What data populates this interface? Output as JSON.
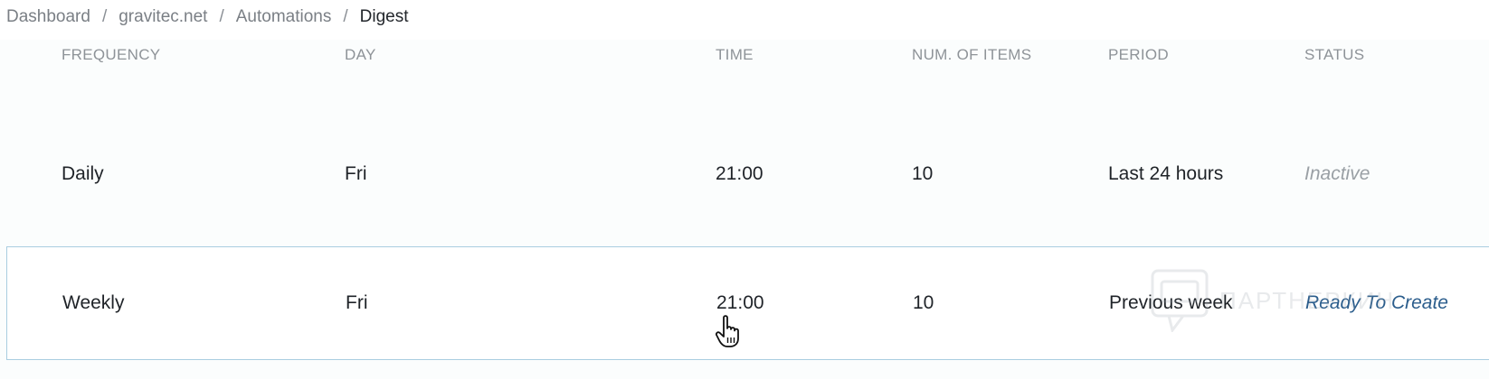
{
  "breadcrumb": {
    "items": [
      "Dashboard",
      "gravitec.net",
      "Automations"
    ],
    "current": "Digest",
    "separator": "/"
  },
  "table": {
    "headers": [
      "FREQUENCY",
      "DAY",
      "TIME",
      "NUM. OF ITEMS",
      "PERIOD",
      "STATUS"
    ],
    "rows": [
      {
        "frequency": "Daily",
        "day": "Fri",
        "time": "21:00",
        "num_items": "10",
        "period": "Last 24 hours",
        "status": "Inactive"
      },
      {
        "frequency": "Weekly",
        "day": "Fri",
        "time": "21:00",
        "num_items": "10",
        "period": "Previous week",
        "status": "Ready To Create"
      }
    ]
  },
  "watermark": {
    "text": "ПАРТНЕРКИН"
  },
  "colors": {
    "accent": "#2b5d8c",
    "selected_border": "#a9cde0",
    "muted": "#9aa0a5"
  },
  "icons": {
    "cursor": "hand-pointer-icon",
    "watermark": "chat-bubble-icon"
  }
}
